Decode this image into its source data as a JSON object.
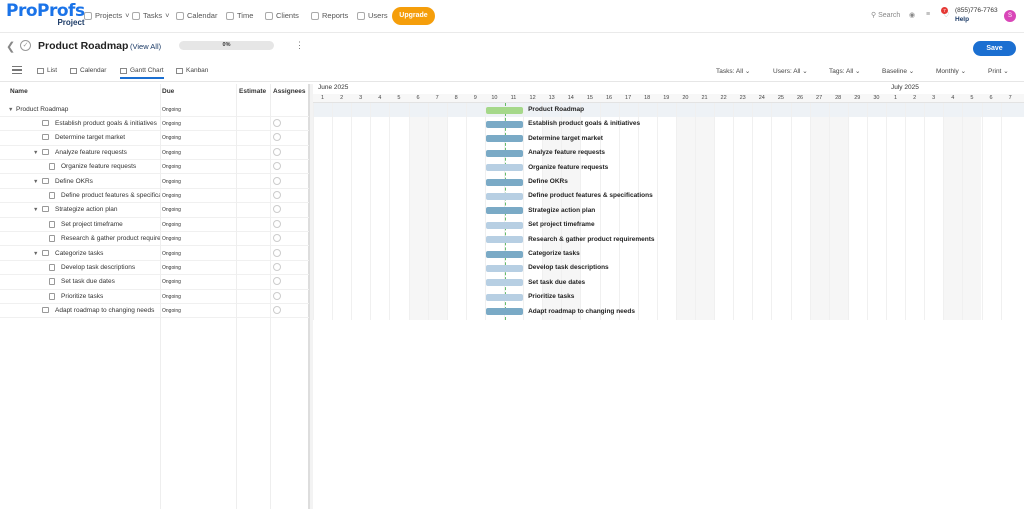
{
  "app": {
    "logo_a": "Pro",
    "logo_b": "Profs",
    "logo_sub": "Project"
  },
  "nav": [
    {
      "label": "Projects",
      "icon": "folder-icon"
    },
    {
      "label": "Tasks",
      "icon": "tasks-icon"
    },
    {
      "label": "Calendar",
      "icon": "calendar-icon"
    },
    {
      "label": "Time",
      "icon": "clock-icon"
    },
    {
      "label": "Clients",
      "icon": "clients-icon"
    },
    {
      "label": "Reports",
      "icon": "reports-icon"
    },
    {
      "label": "Users",
      "icon": "users-icon"
    }
  ],
  "upgrade_label": "Upgrade",
  "search_placeholder": "Search",
  "notif_count": "7",
  "phone": "(855)776-7763",
  "help": "Help",
  "avatar_letter": "S",
  "project": {
    "title": "Product Roadmap",
    "view_all": "(View All)",
    "progress": "0%",
    "save": "Save"
  },
  "views": {
    "list": "List",
    "calendar": "Calendar",
    "gantt": "Gantt Chart",
    "kanban": "Kanban"
  },
  "filters": {
    "tasks": "Tasks: All",
    "users": "Users: All",
    "tags": "Tags: All",
    "baseline": "Baseline",
    "scale": "Monthly",
    "print": "Print"
  },
  "columns": {
    "name": "Name",
    "due": "Due",
    "estimate": "Estimate",
    "assignees": "Assignees"
  },
  "tasks": [
    {
      "name": "Product Roadmap",
      "due": "Ongoing",
      "level": 0,
      "kind": "root",
      "bar": "green"
    },
    {
      "name": "Establish product goals & initiatives",
      "due": "Ongoing",
      "level": 1,
      "kind": "folder",
      "bar": "dark"
    },
    {
      "name": "Determine target market",
      "due": "Ongoing",
      "level": 1,
      "kind": "folder",
      "bar": "dark"
    },
    {
      "name": "Analyze feature requests",
      "due": "Ongoing",
      "level": 1,
      "kind": "group",
      "bar": "dark"
    },
    {
      "name": "Organize feature requests",
      "due": "Ongoing",
      "level": 2,
      "kind": "doc",
      "bar": "light"
    },
    {
      "name": "Define OKRs",
      "due": "Ongoing",
      "level": 1,
      "kind": "group",
      "bar": "dark"
    },
    {
      "name": "Define product features & specifications",
      "due": "Ongoing",
      "level": 2,
      "kind": "doc",
      "bar": "light"
    },
    {
      "name": "Strategize action plan",
      "due": "Ongoing",
      "level": 1,
      "kind": "group",
      "bar": "dark"
    },
    {
      "name": "Set project timeframe",
      "due": "Ongoing",
      "level": 2,
      "kind": "doc",
      "bar": "light"
    },
    {
      "name": "Research & gather product requirements",
      "due": "Ongoing",
      "level": 2,
      "kind": "doc",
      "bar": "light"
    },
    {
      "name": "Categorize tasks",
      "due": "Ongoing",
      "level": 1,
      "kind": "group",
      "bar": "dark"
    },
    {
      "name": "Develop task descriptions",
      "due": "Ongoing",
      "level": 2,
      "kind": "doc",
      "bar": "light"
    },
    {
      "name": "Set task due dates",
      "due": "Ongoing",
      "level": 2,
      "kind": "doc",
      "bar": "light"
    },
    {
      "name": "Prioritize tasks",
      "due": "Ongoing",
      "level": 2,
      "kind": "doc",
      "bar": "light"
    },
    {
      "name": "Adapt roadmap to changing needs",
      "due": "Ongoing",
      "level": 1,
      "kind": "folder",
      "bar": "dark"
    }
  ],
  "timeline": {
    "months": [
      {
        "label": "June 2025",
        "start_index": 0
      },
      {
        "label": "July 2025",
        "start_index": 30
      }
    ],
    "days": [
      "1",
      "2",
      "3",
      "4",
      "5",
      "6",
      "7",
      "8",
      "9",
      "10",
      "11",
      "12",
      "13",
      "14",
      "15",
      "16",
      "17",
      "18",
      "19",
      "20",
      "21",
      "22",
      "23",
      "24",
      "25",
      "26",
      "27",
      "28",
      "29",
      "30",
      "1",
      "2",
      "3",
      "4",
      "5",
      "6",
      "7"
    ],
    "weekend_indices": [
      5,
      6,
      12,
      13,
      19,
      20,
      26,
      27,
      33,
      34
    ],
    "bar_start_index": 9,
    "bar_days": 2
  },
  "colors": {
    "green": "#a5d88a",
    "dark": "#7aaac6",
    "light": "#b7cfe3",
    "accent": "#1b6fd1",
    "upgrade": "#f59e0b"
  }
}
